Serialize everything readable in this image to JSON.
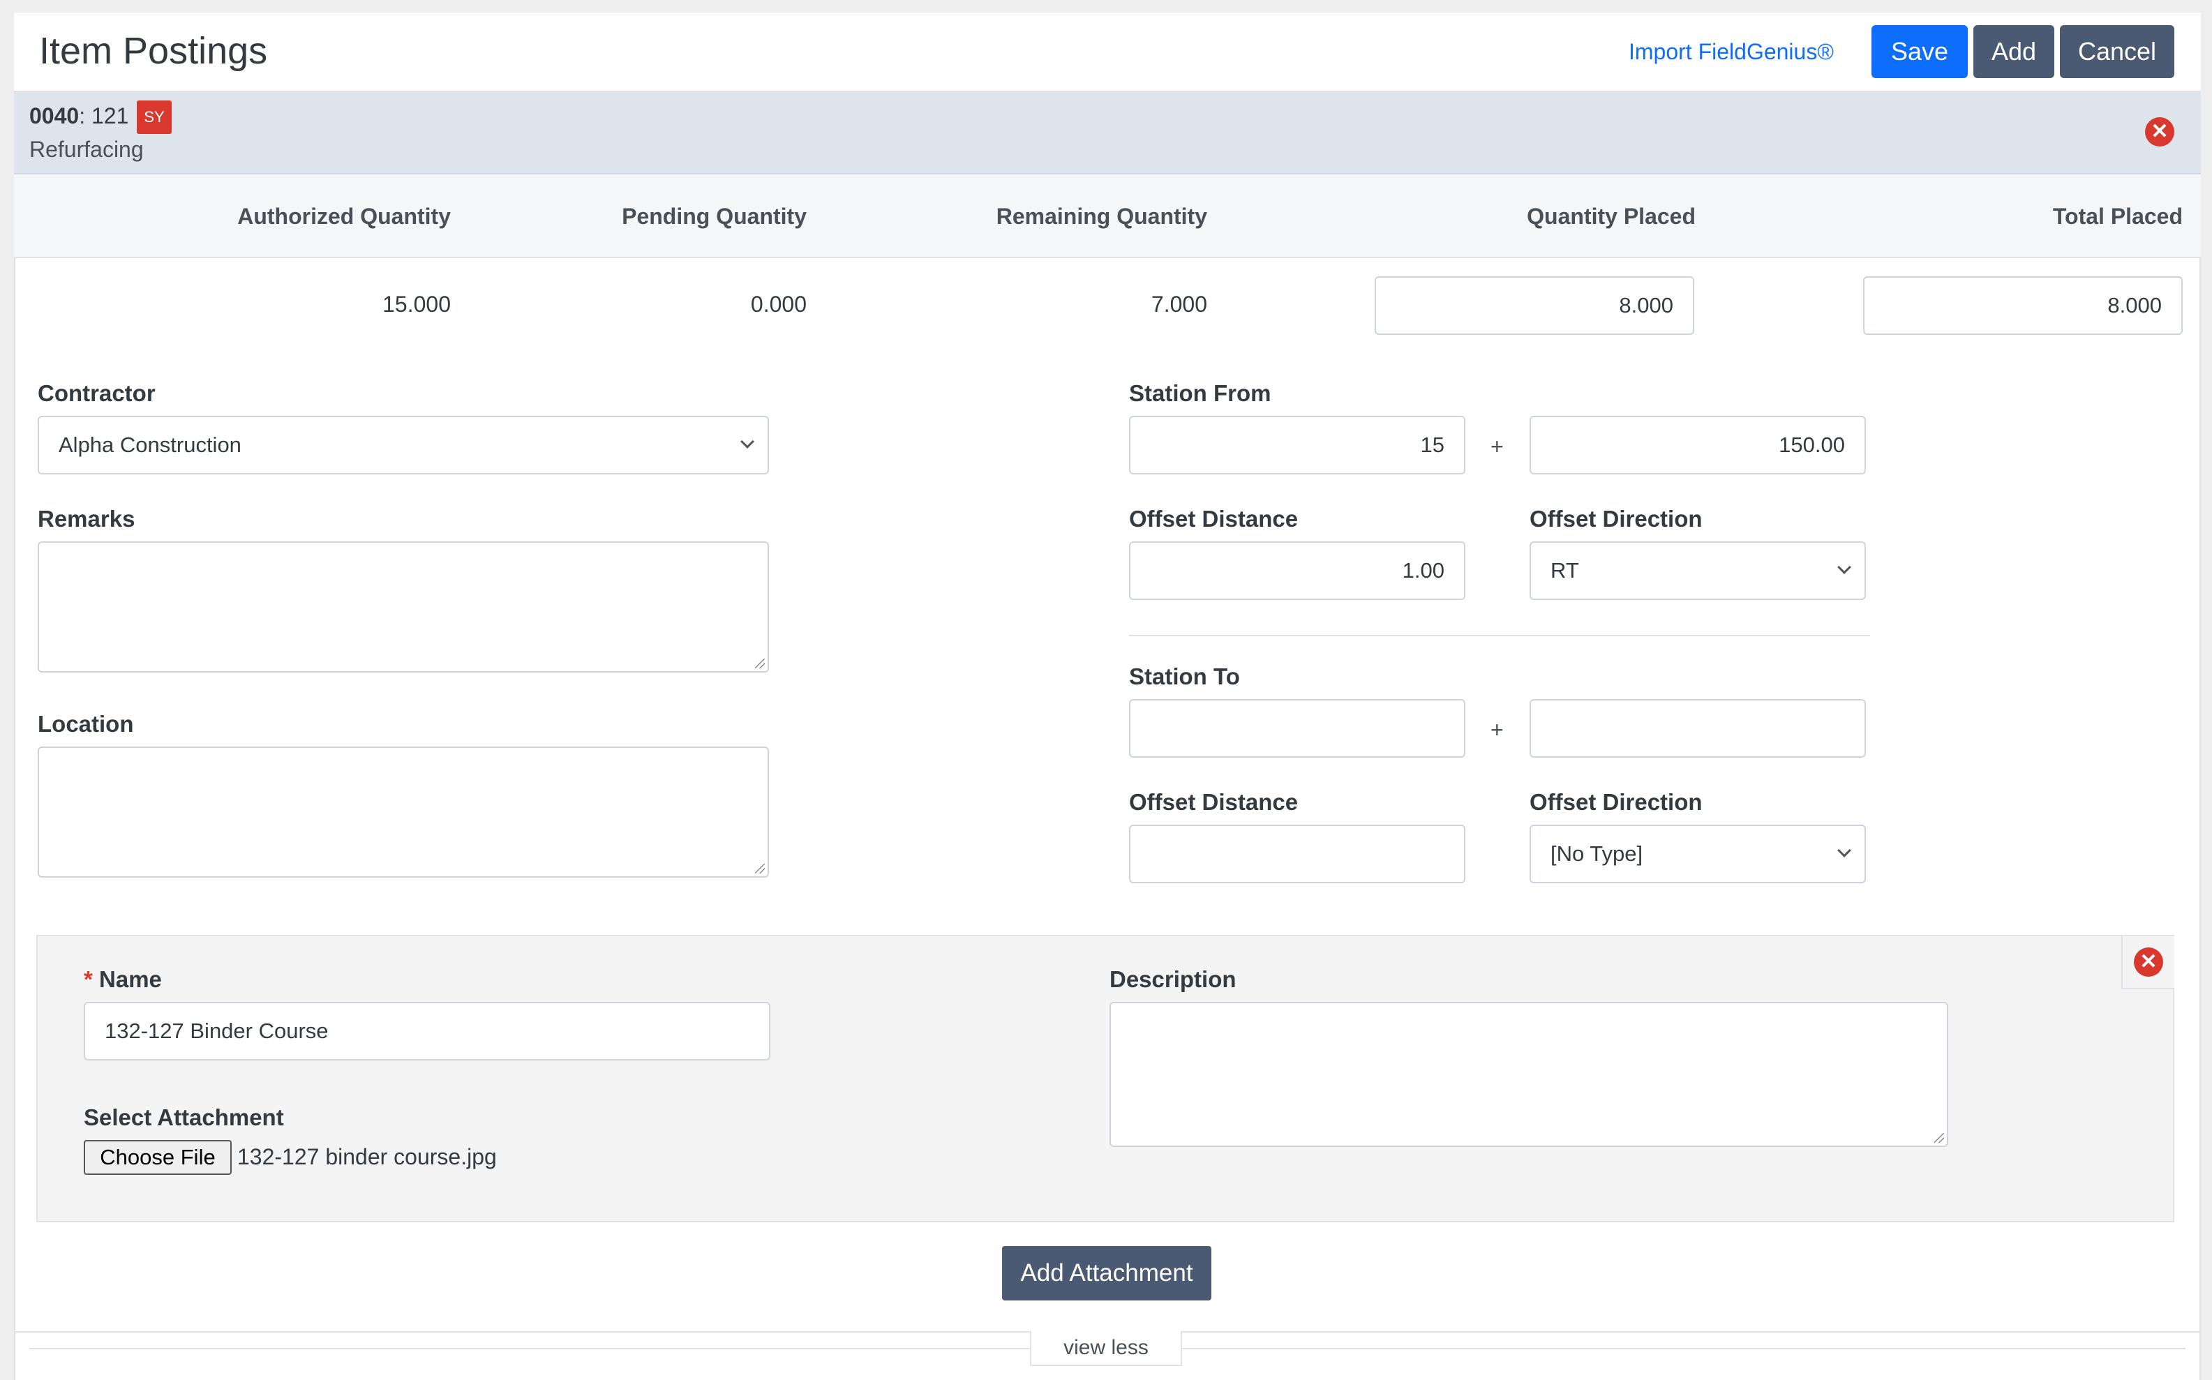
{
  "header": {
    "title": "Item Postings",
    "import_link": "Import FieldGenius®",
    "save_label": "Save",
    "add_label": "Add",
    "cancel_label": "Cancel"
  },
  "item": {
    "code": "0040",
    "number": ": 121",
    "unit_badge": "SY",
    "description": "Refurfacing",
    "close_glyph": "✕"
  },
  "quantities": {
    "headers": {
      "authorized": "Authorized Quantity",
      "pending": "Pending Quantity",
      "remaining": "Remaining Quantity",
      "placed": "Quantity Placed",
      "total": "Total Placed"
    },
    "values": {
      "authorized": "15.000",
      "pending": "0.000",
      "remaining": "7.000",
      "placed": "8.000",
      "total": "8.000"
    }
  },
  "form": {
    "contractor_label": "Contractor",
    "contractor_value": "Alpha Construction",
    "remarks_label": "Remarks",
    "location_label": "Location",
    "station_from_label": "Station From",
    "station_from_a": "15",
    "station_from_b": "150.00",
    "plus": "+",
    "offset_distance_label": "Offset Distance",
    "offset_distance_from": "1.00",
    "offset_direction_label": "Offset Direction",
    "offset_direction_from": "RT",
    "station_to_label": "Station To",
    "station_to_a": "",
    "station_to_b": "",
    "offset_distance_to": "",
    "offset_direction_to": "[No Type]"
  },
  "attachment": {
    "required_mark": "*",
    "name_label": "Name",
    "name_value": "132-127 Binder Course",
    "description_label": "Description",
    "select_label": "Select Attachment",
    "choose_file_label": "Choose File",
    "file_name": "132-127 binder course.jpg",
    "close_glyph": "✕",
    "add_attachment_label": "Add Attachment"
  },
  "footer": {
    "view_less": "view less"
  },
  "colors": {
    "primary": "#0d6efd",
    "dark_button": "#495a72",
    "danger": "#d9382f"
  }
}
